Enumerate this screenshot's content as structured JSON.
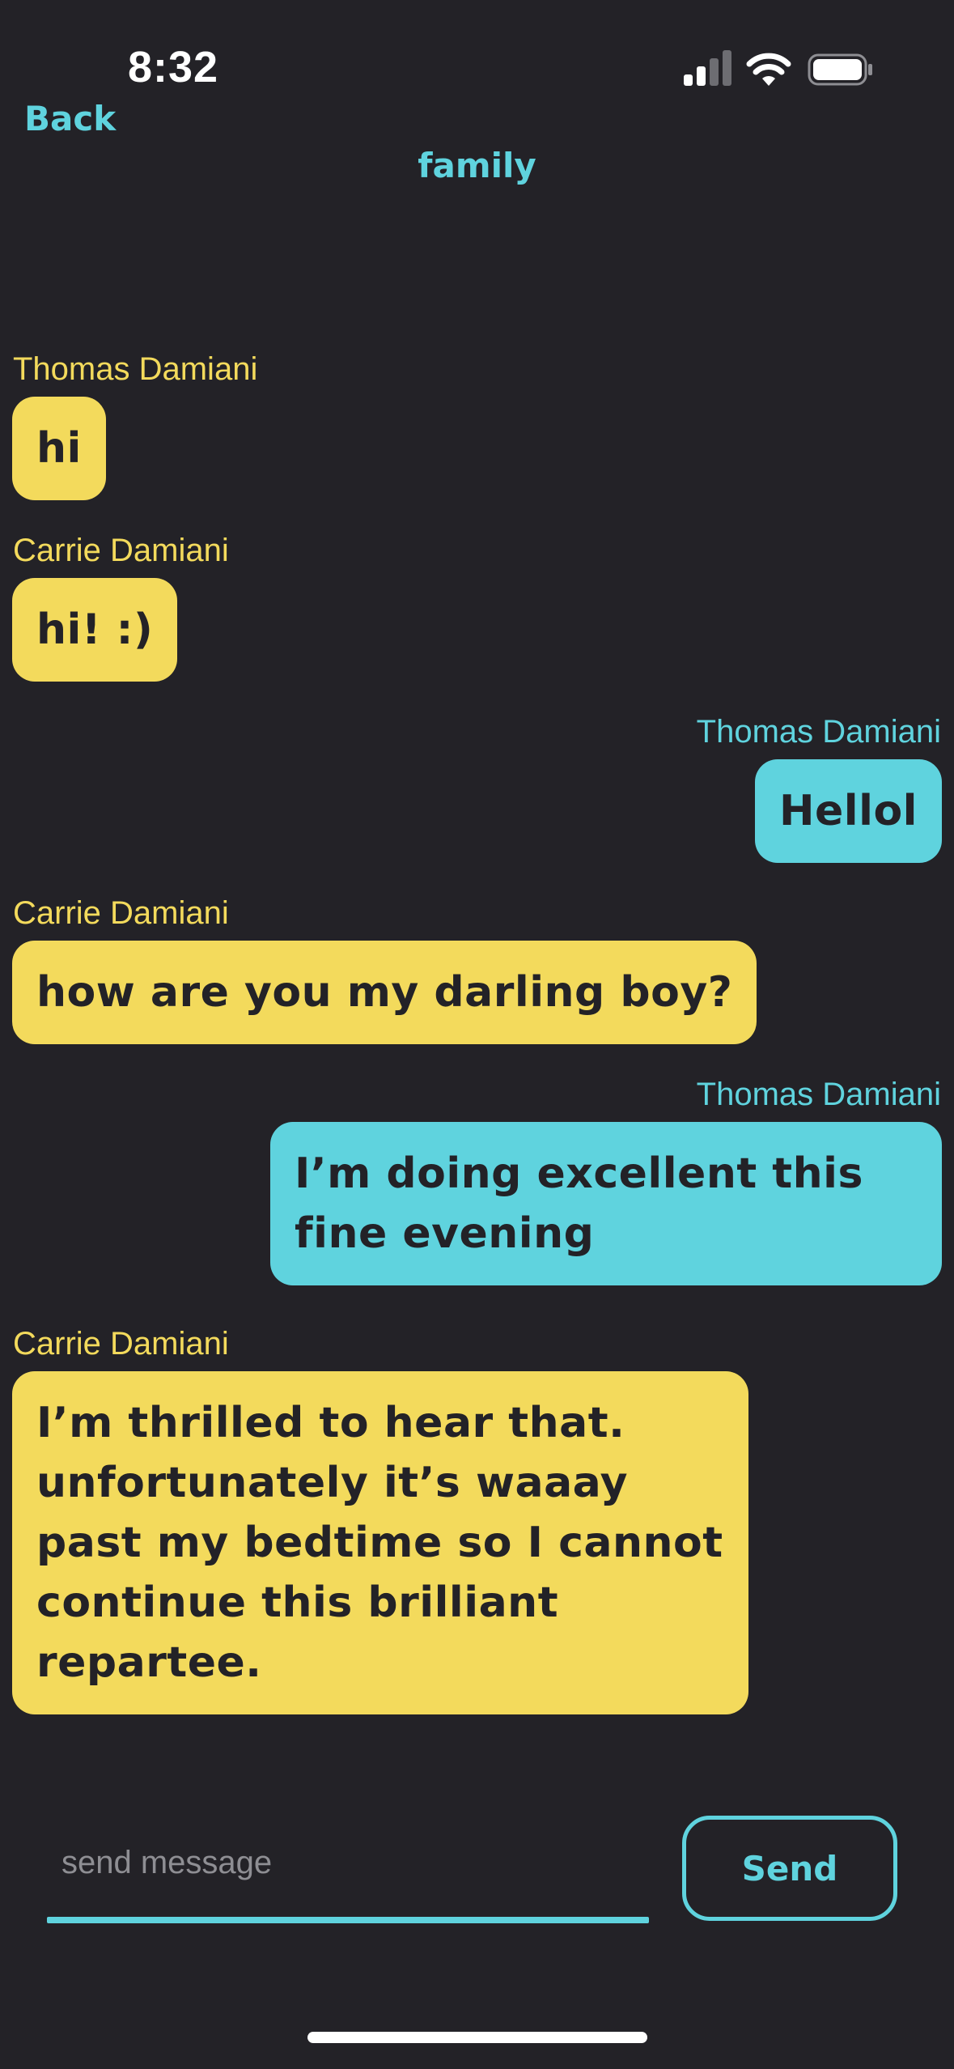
{
  "status_bar": {
    "time": "8:32",
    "signal_icon": "cellular-signal-icon",
    "wifi_icon": "wifi-icon",
    "battery_icon": "battery-icon"
  },
  "header": {
    "back_label": "Back",
    "title": "family"
  },
  "messages": [
    {
      "sender": "Thomas Damiani",
      "side": "left",
      "text": "hi"
    },
    {
      "sender": "Carrie Damiani",
      "side": "left",
      "text": "hi! :)"
    },
    {
      "sender": "Thomas Damiani",
      "side": "right",
      "text": "Hellol"
    },
    {
      "sender": "Carrie Damiani",
      "side": "left",
      "text": "how are you my darling boy?"
    },
    {
      "sender": "Thomas Damiani",
      "side": "right",
      "text": "I’m doing excellent this fine evening"
    },
    {
      "sender": "Carrie Damiani",
      "side": "left",
      "text": "I’m thrilled to hear that. unfortunately it’s waaay past my bedtime so I cannot continue this brilliant repartee."
    }
  ],
  "composer": {
    "value": "",
    "placeholder": "send message",
    "send_label": "Send"
  },
  "colors": {
    "background": "#232227",
    "accent_cyan": "#5fd3de",
    "accent_yellow": "#f3da5c"
  }
}
